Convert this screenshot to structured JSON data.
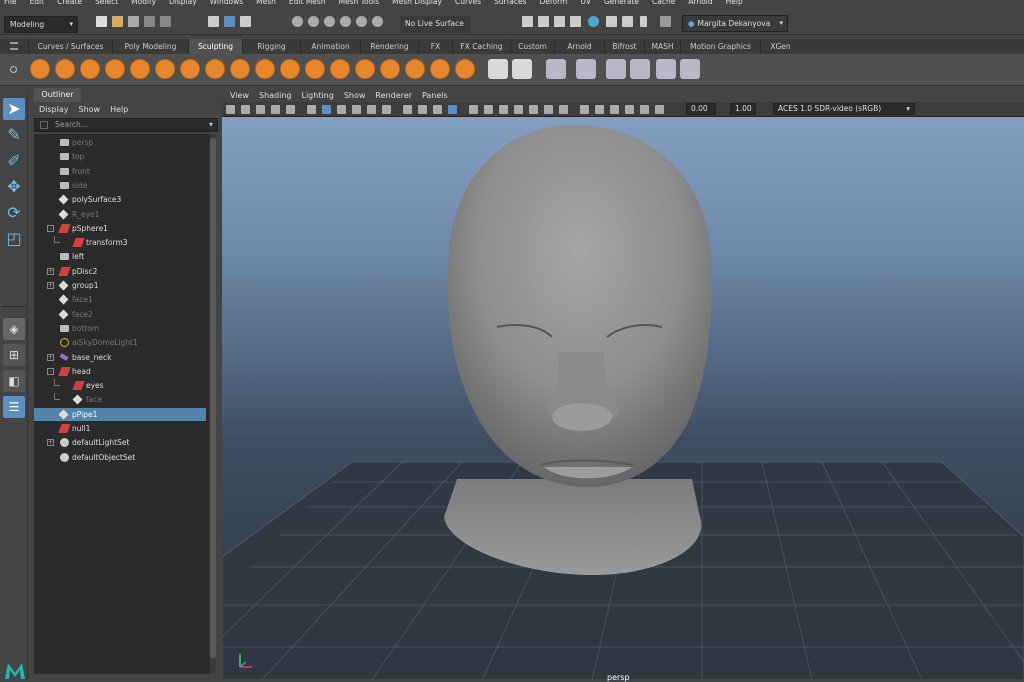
{
  "menubar": [
    "File",
    "Edit",
    "Create",
    "Select",
    "Modify",
    "Display",
    "Windows",
    "Mesh",
    "Edit Mesh",
    "Mesh Tools",
    "Mesh Display",
    "Curves",
    "Surfaces",
    "Deform",
    "UV",
    "Generate",
    "Cache",
    "Arnold",
    "Help"
  ],
  "statusline": {
    "mode": "Modeling",
    "live_surface": "No Live Surface",
    "user": "Margita Dekanyova"
  },
  "shelf_tabs": [
    "Curves / Surfaces",
    "Poly Modeling",
    "Sculpting",
    "Rigging",
    "Animation",
    "Rendering",
    "FX",
    "FX Caching",
    "Custom",
    "Arnold",
    "Bifrost",
    "MASH",
    "Motion Graphics",
    "XGen"
  ],
  "active_shelf_tab": "Sculpting",
  "outliner": {
    "tab": "Outliner",
    "menu": [
      "Display",
      "Show",
      "Help"
    ],
    "search_placeholder": "Search...",
    "items": [
      {
        "label": "persp",
        "icon": "camera-icon",
        "dim": true,
        "indent": 0
      },
      {
        "label": "top",
        "icon": "camera-icon",
        "dim": true,
        "indent": 0
      },
      {
        "label": "front",
        "icon": "camera-icon",
        "dim": true,
        "indent": 0
      },
      {
        "label": "side",
        "icon": "camera-icon",
        "dim": true,
        "indent": 0
      },
      {
        "label": "polySurface3",
        "icon": "mesh-icon",
        "dim": false,
        "indent": 0
      },
      {
        "label": "R_eye1",
        "icon": "mesh-icon",
        "dim": true,
        "indent": 0
      },
      {
        "label": "pSphere1",
        "icon": "transform-icon",
        "dim": false,
        "indent": 0,
        "expand": "-"
      },
      {
        "label": "transform3",
        "icon": "transform-icon",
        "dim": false,
        "indent": 1
      },
      {
        "label": "left",
        "icon": "camera-icon",
        "dim": false,
        "indent": 0
      },
      {
        "label": "pDisc2",
        "icon": "transform-icon",
        "dim": false,
        "indent": 0,
        "expand": "+"
      },
      {
        "label": "group1",
        "icon": "mesh-icon",
        "dim": false,
        "indent": 0,
        "expand": "+"
      },
      {
        "label": "face1",
        "icon": "mesh-icon",
        "dim": true,
        "indent": 0
      },
      {
        "label": "face2",
        "icon": "mesh-icon",
        "dim": true,
        "indent": 0
      },
      {
        "label": "bottom",
        "icon": "camera-icon",
        "dim": true,
        "indent": 0
      },
      {
        "label": "aiSkyDomeLight1",
        "icon": "light-icon",
        "dim": true,
        "indent": 0
      },
      {
        "label": "base_neck",
        "icon": "joint-icon",
        "dim": false,
        "indent": 0,
        "expand": "+"
      },
      {
        "label": "head",
        "icon": "transform-icon",
        "dim": false,
        "indent": 0,
        "expand": "-"
      },
      {
        "label": "eyes",
        "icon": "transform-icon",
        "dim": false,
        "indent": 1
      },
      {
        "label": "face",
        "icon": "mesh-icon",
        "dim": true,
        "indent": 1
      },
      {
        "label": "pPipe1",
        "icon": "mesh-icon",
        "dim": false,
        "indent": 0,
        "selected": true
      },
      {
        "label": "null1",
        "icon": "transform-icon",
        "dim": false,
        "indent": 0
      },
      {
        "label": "defaultLightSet",
        "icon": "set-icon",
        "dim": false,
        "indent": 0,
        "expand": "+"
      },
      {
        "label": "defaultObjectSet",
        "icon": "set-icon",
        "dim": false,
        "indent": 0
      }
    ]
  },
  "viewport": {
    "menu": [
      "View",
      "Shading",
      "Lighting",
      "Show",
      "Renderer",
      "Panels"
    ],
    "exposure": "0.00",
    "gamma": "1.00",
    "color_space": "ACES 1.0 SDR-video (sRGB)",
    "camera": "persp"
  },
  "colors": {
    "accent": "#5285a6",
    "sculpt_orange": "#e8862b"
  }
}
